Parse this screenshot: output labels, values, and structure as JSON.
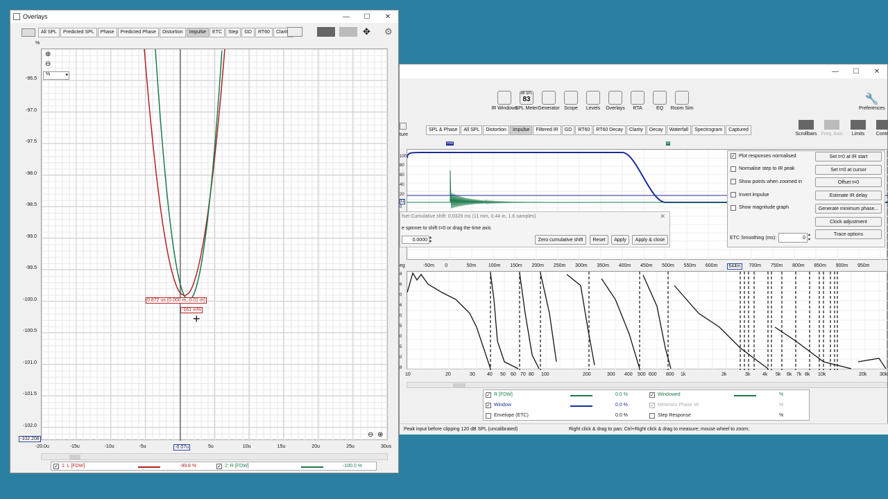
{
  "overlays": {
    "title": "Overlays",
    "tabs": [
      "All SPL",
      "Predicted SPL",
      "Phase",
      "Predicted Phase",
      "Distortion",
      "Impulse",
      "ETC",
      "Step",
      "GD",
      "RT60",
      "Clarity"
    ],
    "active_tab": "Impulse",
    "unit_top": "%",
    "unit_select": "%",
    "y_ticks": [
      "-96.5",
      "-97.0",
      "-97.5",
      "-98.0",
      "-98.5",
      "-99.0",
      "-99.5",
      "-100.0",
      "-100.5",
      "-101.0",
      "-101.5",
      "-102.0"
    ],
    "y_bottom_readout": "-102.208",
    "x_ticks": [
      "-20.0u",
      "-15u",
      "-10u",
      "-5u",
      "-0.07u",
      "5u",
      "10u",
      "15u",
      "20u",
      "25u",
      "30us"
    ],
    "cursor_label1": "0.872 us (0.000 m, 0.01 in)",
    "cursor_label2": "-161 m%",
    "legend": [
      {
        "label": "1: L [FDW]",
        "value": "-99.8 %",
        "color": "#b22222"
      },
      {
        "label": "2: R [FDW]",
        "value": "-100.0 %",
        "color": "#1a7a4a"
      }
    ]
  },
  "main": {
    "toolbar": [
      {
        "label": "IR Windows",
        "icon": "ir-windows-icon"
      },
      {
        "label": "SPL Meter",
        "icon": "spl-meter-icon",
        "badge_top": "dB SPL",
        "badge_value": "83"
      },
      {
        "label": "Generator",
        "icon": "generator-icon"
      },
      {
        "label": "Scope",
        "icon": "scope-icon"
      },
      {
        "label": "Levels",
        "icon": "levels-icon"
      },
      {
        "label": "Overlays",
        "icon": "overlays-icon"
      },
      {
        "label": "RTA",
        "icon": "rta-icon"
      },
      {
        "label": "EQ",
        "icon": "eq-icon"
      },
      {
        "label": "Room Sim",
        "icon": "room-sim-icon"
      }
    ],
    "preferences": "Preferences",
    "left_cut_label": "ture",
    "tabs": [
      "SPL & Phase",
      "All SPL",
      "Distortion",
      "Impulse",
      "Filtered IR",
      "GD",
      "RT60",
      "RT60 Decay",
      "Clarity",
      "Decay",
      "Waterfall",
      "Spectrogram",
      "Captured"
    ],
    "active_tab": "Impulse",
    "right_tools": [
      "Scrollbars",
      "Freq. Axis",
      "Limits",
      "Control"
    ],
    "ref_marker": "Ref",
    "r_marker": "R",
    "impulse_y_labels": [
      "100",
      "80",
      "60",
      "40",
      "20",
      "11",
      "0"
    ],
    "offset_panel": {
      "title": "fset  Cumulative shift: 0.0329 ms (11 mm, 0.44 in, 1.6 samples)",
      "hint": "e spinner to shift t=0 or drag the time axis",
      "value": "0.0000",
      "buttons": [
        "Zero cumulative shift",
        "Reset",
        "Apply",
        "Apply & close"
      ]
    },
    "options_panel": {
      "checks": [
        {
          "label": "Plot responses normalised",
          "checked": true
        },
        {
          "label": "Normalise step to IR peak",
          "checked": false
        },
        {
          "label": "Show points when zoomed in",
          "checked": false
        },
        {
          "label": "Invert impulse",
          "checked": false
        },
        {
          "label": "Show magnitude graph",
          "checked": false
        }
      ],
      "buttons": [
        "Set t=0 at IR start",
        "Set t=0 at cursor",
        "Offset t=0",
        "Estimate IR delay",
        "Generate minimum phase...",
        "Clock adjustment",
        "Trace options"
      ],
      "etc_label": "ETC Smoothing (ms):",
      "etc_value": "0"
    },
    "time_axis": [
      "-50m",
      "0",
      "50m",
      "100m",
      "150m",
      "200m",
      "250m",
      "300m",
      "350m",
      "400m",
      "450m",
      "500m",
      "550m",
      "600m",
      "644m",
      "700m",
      "750m",
      "800m",
      "850m",
      "900m",
      "950m"
    ],
    "time_axis_left": "eg",
    "phase_y_labels": [
      "8",
      "6",
      "0",
      "6",
      "0",
      "5",
      "0",
      "5",
      "0",
      "8"
    ],
    "freq_axis": [
      "10",
      "20",
      "30",
      "40",
      "50",
      "60",
      "70",
      "80",
      "100",
      "200",
      "300",
      "400",
      "500",
      "600",
      "800",
      "1k",
      "2k",
      "3k",
      "4k",
      "5k",
      "6k",
      "7k",
      "8k",
      "10k",
      "20k",
      "30kH"
    ],
    "legend": [
      {
        "label": "R [FDW]",
        "value": "0.0 %",
        "color": "#1a7a4a",
        "checked": true
      },
      {
        "label": "Window",
        "value": "0.0 %",
        "color": "#1a2a9a",
        "checked": true
      },
      {
        "label": "Envelope (ETC)",
        "value": "0.0 %",
        "color": "",
        "checked": false
      },
      {
        "label": "Windowed",
        "value": "%",
        "color": "#1a7a4a",
        "checked": true
      },
      {
        "label": "Minimum Phase IR",
        "value": "%",
        "color": "",
        "checked": true
      },
      {
        "label": "Step Response",
        "value": "%",
        "color": "",
        "checked": false
      }
    ],
    "status_left": "Peak input before clipping 120 dB SPL (uncalibrated)",
    "status_right": "Right click & drag to pan; Ctrl+Right click & drag to measure; mouse wheel to zoom;"
  }
}
